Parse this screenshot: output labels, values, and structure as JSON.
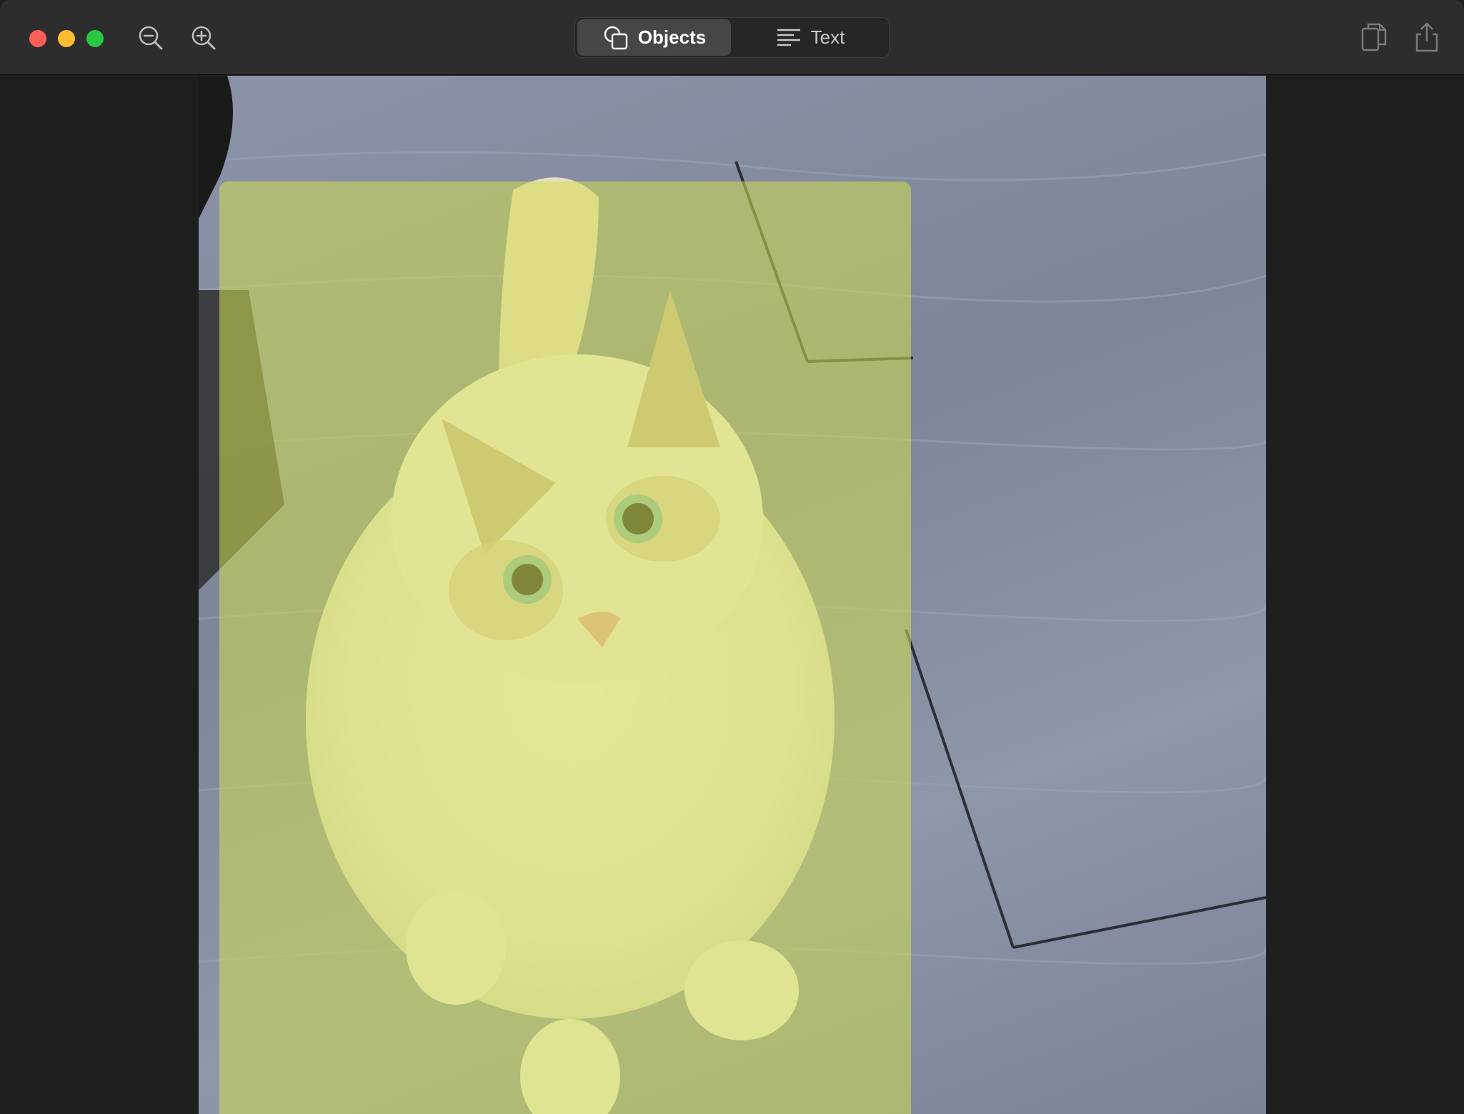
{
  "window": {
    "traffic_lights": [
      "close",
      "minimize",
      "zoom"
    ]
  },
  "toolbar": {
    "zoom_out_icon": "zoom-out-icon",
    "zoom_in_icon": "zoom-in-icon",
    "tabs": [
      {
        "label": "Objects",
        "icon": "objects-icon",
        "selected": true
      },
      {
        "label": "Text",
        "icon": "text-lines-icon",
        "selected": false
      }
    ],
    "copy_icon": "copy-icon",
    "share_icon": "share-icon"
  },
  "image": {
    "subject": "cat",
    "highlight_color": "#d2de50"
  }
}
